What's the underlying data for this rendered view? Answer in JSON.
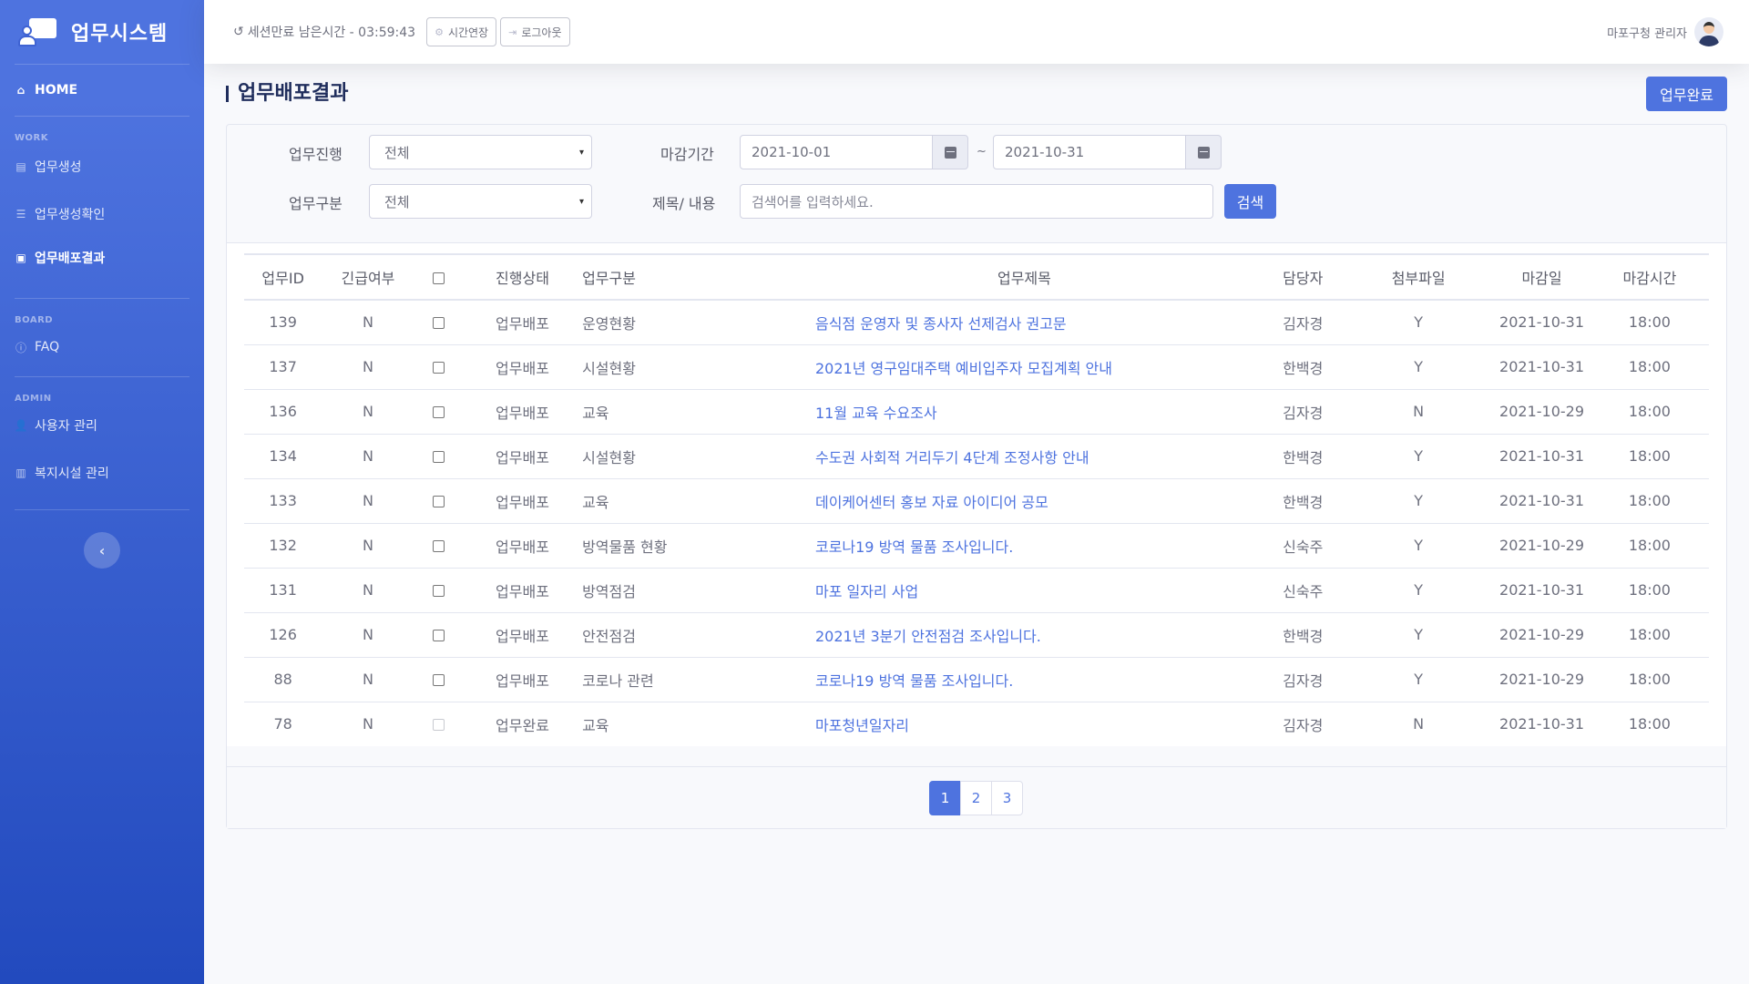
{
  "app": {
    "brand": "업무시스템"
  },
  "sidebar": {
    "home": "HOME",
    "sections": [
      {
        "heading": "WORK",
        "items": [
          "업무생성",
          "업무생성확인",
          "업무배포결과"
        ]
      },
      {
        "heading": "BOARD",
        "items": [
          "FAQ"
        ]
      },
      {
        "heading": "ADMIN",
        "items": [
          "사용자 관리",
          "복지시설 관리"
        ]
      }
    ],
    "active": "업무배포결과"
  },
  "topbar": {
    "session": "세션만료 남은시간 - 03:59:43",
    "extend": "시간연장",
    "logout": "로그아웃",
    "user": "마포구청 관리자"
  },
  "page": {
    "title": "업무배포결과",
    "complete_button": "업무완료"
  },
  "filters": {
    "progress_label": "업무진행",
    "progress_value": "전체",
    "category_label": "업무구분",
    "category_value": "전체",
    "deadline_label": "마감기간",
    "date_from": "2021-10-01",
    "date_to": "2021-10-31",
    "tilde": "~",
    "keyword_label": "제목/ 내용",
    "keyword_placeholder": "검색어를 입력하세요.",
    "search_button": "검색"
  },
  "table": {
    "columns": [
      "업무ID",
      "긴급여부",
      "",
      "진행상태",
      "업무구분",
      "업무제목",
      "담당자",
      "첨부파일",
      "마감일",
      "마감시간"
    ],
    "rows": [
      [
        "139",
        "N",
        "",
        "업무배포",
        "운영현황",
        "음식점 운영자 및 종사자 선제검사 권고문",
        "김자경",
        "Y",
        "2021-10-31",
        "18:00"
      ],
      [
        "137",
        "N",
        "",
        "업무배포",
        "시설현황",
        "2021년 영구임대주택 예비입주자 모집계획 안내",
        "한백경",
        "Y",
        "2021-10-31",
        "18:00"
      ],
      [
        "136",
        "N",
        "",
        "업무배포",
        "교육",
        "11월 교육 수요조사",
        "김자경",
        "N",
        "2021-10-29",
        "18:00"
      ],
      [
        "134",
        "N",
        "",
        "업무배포",
        "시설현황",
        "수도권 사회적 거리두기 4단계 조정사항 안내",
        "한백경",
        "Y",
        "2021-10-31",
        "18:00"
      ],
      [
        "133",
        "N",
        "",
        "업무배포",
        "교육",
        "데이케어센터 홍보 자료 아이디어 공모",
        "한백경",
        "Y",
        "2021-10-31",
        "18:00"
      ],
      [
        "132",
        "N",
        "",
        "업무배포",
        "방역물품 현황",
        "코로나19 방역 물품 조사입니다.",
        "신숙주",
        "Y",
        "2021-10-29",
        "18:00"
      ],
      [
        "131",
        "N",
        "",
        "업무배포",
        "방역점검",
        "마포 일자리 사업",
        "신숙주",
        "Y",
        "2021-10-31",
        "18:00"
      ],
      [
        "126",
        "N",
        "",
        "업무배포",
        "안전점검",
        "2021년 3분기 안전점검 조사입니다.",
        "한백경",
        "Y",
        "2021-10-29",
        "18:00"
      ],
      [
        "88",
        "N",
        "",
        "업무배포",
        "코로나 관련",
        "코로나19 방역 물품 조사입니다.",
        "김자경",
        "Y",
        "2021-10-29",
        "18:00"
      ],
      [
        "78",
        "N",
        "",
        "업무완료",
        "교육",
        "마포청년일자리",
        "김자경",
        "N",
        "2021-10-31",
        "18:00"
      ]
    ]
  },
  "pagination": {
    "pages": [
      "1",
      "2",
      "3"
    ],
    "current": "1"
  },
  "colors": {
    "primary": "#4e73df",
    "sidebar_top": "#4e73df",
    "sidebar_bottom": "#224abe"
  }
}
